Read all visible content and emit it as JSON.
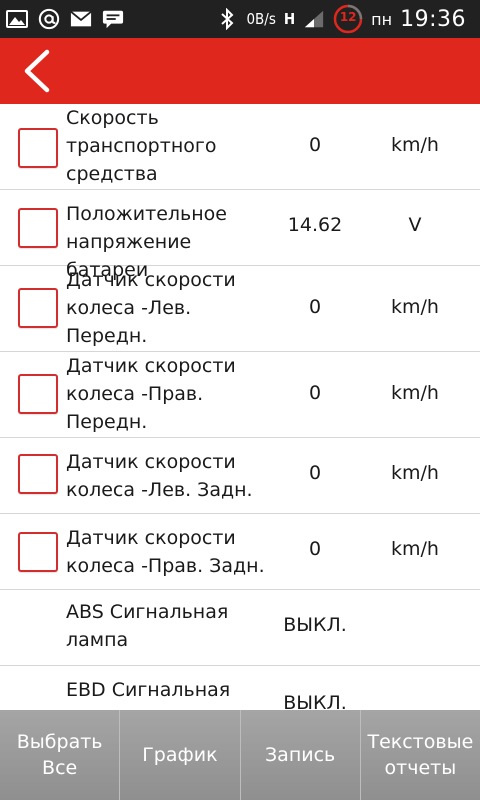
{
  "status_bar": {
    "net_speed": "0B/s",
    "net_type": "H",
    "day": "пн",
    "time": "19:36",
    "notification_count": "12",
    "icons": [
      "image-icon",
      "at-icon",
      "mail-icon",
      "chat-icon",
      "bluetooth-icon",
      "signal-icon"
    ]
  },
  "header": {
    "back_icon": "chevron-left-icon",
    "color": "#e0271e"
  },
  "params": [
    {
      "name": "Скорость транспортного средства",
      "lines": [
        "Скорость",
        "транспортного",
        "средства"
      ],
      "value": "0",
      "unit": "km/h",
      "checkbox": true
    },
    {
      "name": "Положительное напряжение батареи",
      "lines": [
        "Положительное",
        "напряжение батареи"
      ],
      "value": "14.62",
      "unit": "V",
      "checkbox": true
    },
    {
      "name": "Датчик скорости колеса -Лев. Передн.",
      "lines": [
        "Датчик скорости",
        "колеса -Лев.",
        "Передн."
      ],
      "value": "0",
      "unit": "km/h",
      "checkbox": true
    },
    {
      "name": "Датчик скорости колеса -Прав. Передн.",
      "lines": [
        "Датчик скорости",
        "колеса -Прав.",
        "Передн."
      ],
      "value": "0",
      "unit": "km/h",
      "checkbox": true
    },
    {
      "name": "Датчик скорости колеса -Лев. Задн.",
      "lines": [
        "Датчик скорости",
        "колеса -Лев. Задн."
      ],
      "value": "0",
      "unit": "km/h",
      "checkbox": true
    },
    {
      "name": "Датчик скорости колеса -Прав. Задн.",
      "lines": [
        "Датчик скорости",
        "колеса -Прав. Задн."
      ],
      "value": "0",
      "unit": "km/h",
      "checkbox": true
    },
    {
      "name": "ABS Сигнальная лампа",
      "lines": [
        "ABS Сигнальная",
        "лампа"
      ],
      "value": "ВЫКЛ.",
      "unit": "",
      "checkbox": false
    },
    {
      "name": "EBD Сигнальная",
      "lines": [
        "EBD Сигнальная"
      ],
      "value": "ВЫКЛ.",
      "unit": "",
      "checkbox": false
    }
  ],
  "toolbar": {
    "select_all": "Выбрать Все",
    "graph": "График",
    "record": "Запись",
    "text_reports": "Текстовые отчеты"
  },
  "colors": {
    "accent": "#e0271e",
    "checkbox_border": "#d32d2d",
    "toolbar": "#9e9e9e"
  }
}
